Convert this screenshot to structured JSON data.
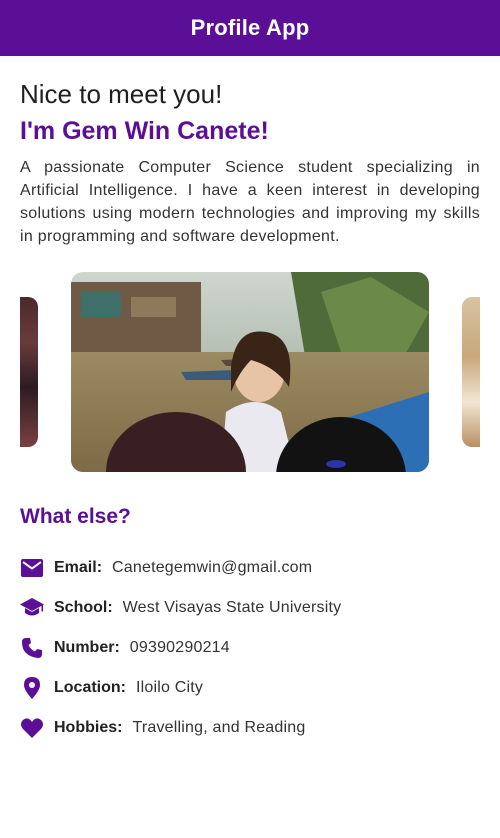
{
  "appbar": {
    "title": "Profile App"
  },
  "intro": {
    "greeting": "Nice to meet you!",
    "name": "I'm Gem Win Canete!",
    "bio": "A passionate Computer Science student specializing in Artificial Intelligence. I have a keen interest in developing solutions using modern technologies and improving my skills in programming and software development."
  },
  "section": {
    "title": "What else?"
  },
  "info": [
    {
      "icon": "email-icon",
      "label": "Email:",
      "value": "Canetegemwin@gmail.com"
    },
    {
      "icon": "school-icon",
      "label": "School:",
      "value": "West Visayas State University"
    },
    {
      "icon": "phone-icon",
      "label": "Number:",
      "value": "09390290214"
    },
    {
      "icon": "location-icon",
      "label": "Location:",
      "value": "Iloilo City"
    },
    {
      "icon": "heart-icon",
      "label": "Hobbies:",
      "value": "Travelling, and Reading"
    }
  ],
  "colors": {
    "primary": "#5b0f96",
    "background": "#ffffff"
  }
}
